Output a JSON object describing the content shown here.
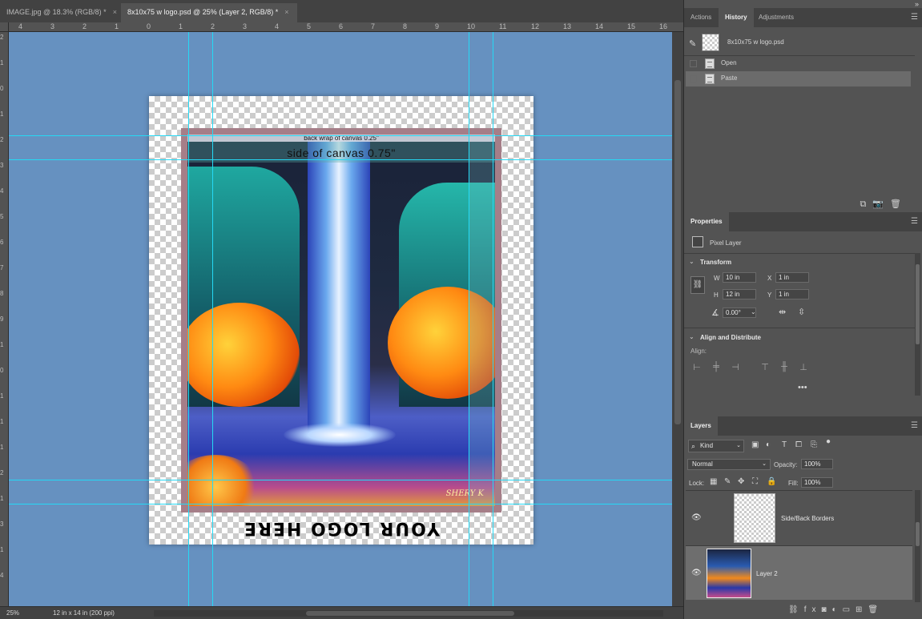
{
  "document_tabs": [
    {
      "label": "IMAGE.jpg @ 18.3% (RGB/8) *",
      "close": "×"
    },
    {
      "label": "8x10x75 w logo.psd @ 25% (Layer 2, RGB/8) *",
      "close": "×"
    }
  ],
  "ruler": {
    "top": [
      "4",
      "3",
      "2",
      "1",
      "0",
      "1",
      "2",
      "3",
      "4",
      "5",
      "6",
      "7",
      "8",
      "9",
      "10",
      "11",
      "12",
      "13",
      "14",
      "15",
      "16"
    ],
    "left": [
      "2",
      "1",
      "0",
      "1",
      "2",
      "3",
      "4",
      "5",
      "6",
      "7",
      "8",
      "9",
      "1",
      "0",
      "1",
      "1",
      "1",
      "2",
      "1",
      "3",
      "1",
      "4"
    ]
  },
  "canvas": {
    "back_wrap_text": "back wrap of canvas 0.25\"",
    "side_text": "side of canvas 0.75\"",
    "logo_text": "YOUR LOGO HERE",
    "signature": "SHERY K"
  },
  "status": {
    "zoom": "25%",
    "doc_size": "12 in x 14 in (200 ppi)"
  },
  "history_panel": {
    "tabs": [
      "Actions",
      "History",
      "Adjustments"
    ],
    "active_tab": "History",
    "snapshot": "8x10x75 w logo.psd",
    "states": [
      "Open",
      "Paste"
    ],
    "selected_state": "Paste"
  },
  "properties_panel": {
    "tab": "Properties",
    "layer_type": "Pixel Layer",
    "transform_title": "Transform",
    "w_label": "W",
    "w_value": "10 in",
    "h_label": "H",
    "h_value": "12 in",
    "x_label": "X",
    "x_value": "1 in",
    "y_label": "Y",
    "y_value": "1 in",
    "angle_value": "0.00°",
    "align_title": "Align and Distribute",
    "align_label": "Align:",
    "more": "•••"
  },
  "layers_panel": {
    "tab": "Layers",
    "filter_kind": "Kind",
    "blend_mode": "Normal",
    "opacity_label": "Opacity:",
    "opacity_value": "100%",
    "lock_label": "Lock:",
    "fill_label": "Fill:",
    "fill_value": "100%",
    "layers": [
      {
        "name": "Side/Back Borders",
        "visible": true,
        "selected": false
      },
      {
        "name": "Layer 2",
        "visible": true,
        "selected": true
      }
    ]
  },
  "colors": {
    "workspace": "#6691c0",
    "guide": "#25d9f5",
    "panel": "#535353",
    "panel_dark": "#424242"
  }
}
